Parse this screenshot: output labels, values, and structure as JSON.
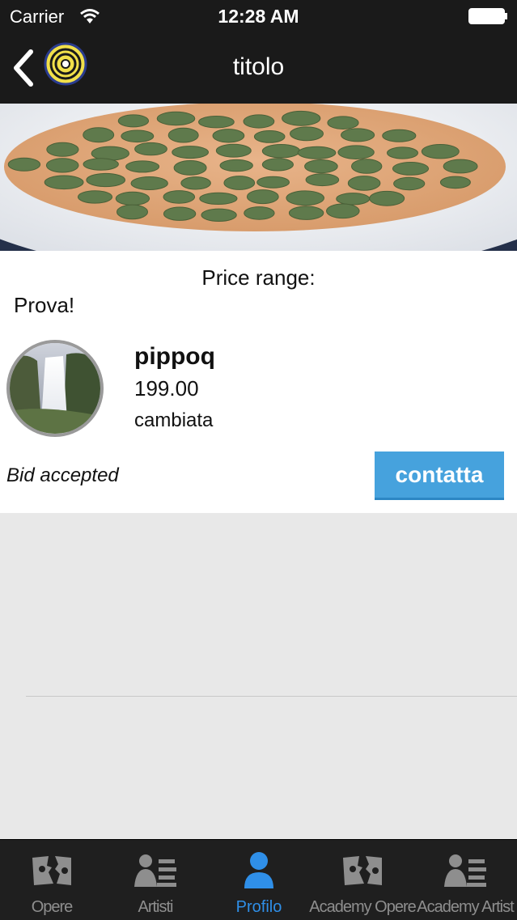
{
  "status_bar": {
    "carrier": "Carrier",
    "time": "12:28 AM"
  },
  "nav": {
    "title": "titolo"
  },
  "listing": {
    "price_range_label": "Price range:",
    "description": "Prova!"
  },
  "bid": {
    "user_name": "pippoq",
    "amount": "199.00",
    "note": "cambiata",
    "status": "Bid accepted",
    "contact_label": "contatta"
  },
  "tabs": [
    {
      "label": "Opere",
      "icon": "artworks-icon",
      "active": false
    },
    {
      "label": "Artisti",
      "icon": "artists-icon",
      "active": false
    },
    {
      "label": "Profilo",
      "icon": "profile-icon",
      "active": true
    },
    {
      "label": "Academy Opere",
      "icon": "academy-artworks-icon",
      "active": false
    },
    {
      "label": "Academy Artist",
      "icon": "academy-artists-icon",
      "active": false
    }
  ],
  "colors": {
    "bar_background": "#1a1a1a",
    "accent_blue": "#46a2dd",
    "active_tab": "#2f8fe8",
    "inactive_tab": "#8e8e8e"
  }
}
